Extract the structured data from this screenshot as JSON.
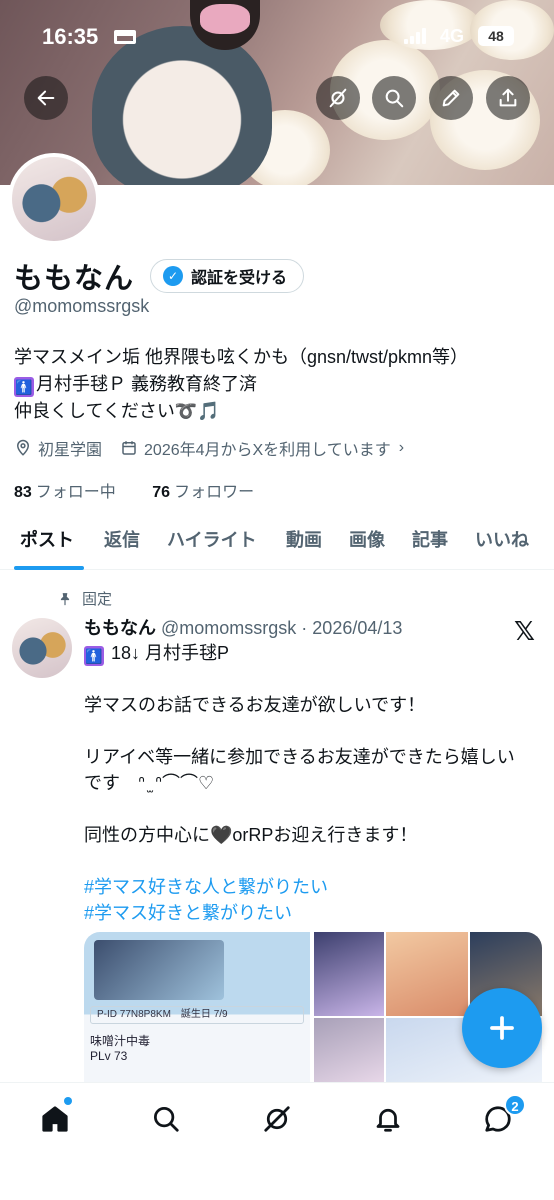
{
  "status_bar": {
    "time": "16:35",
    "network": "4G",
    "battery": "48"
  },
  "profile": {
    "name": "ももなん",
    "verify_label": "認証を受ける",
    "handle": "@momomssrgsk",
    "bio_line1": "学マスメイン垢 他界隈も呟くかも（gnsn/twst/pkmn等）",
    "bio_line2": "月村手毬Ｐ 義務教育終了済",
    "bio_line3": "仲良くしてください➰🎵",
    "location": "初星学園",
    "joined": "2026年4月からXを利用しています",
    "following_count": "83",
    "following_label": "フォロー中",
    "followers_count": "76",
    "followers_label": "フォロワー"
  },
  "tabs": [
    "ポスト",
    "返信",
    "ハイライト",
    "動画",
    "画像",
    "記事",
    "いいね"
  ],
  "post": {
    "pinned_label": "固定",
    "author": "ももなん",
    "meta": "@momomssrgsk · 2026/04/13",
    "line_intro": "18↓ 月村手毬P",
    "para1": "学マスのお話できるお友達が欲しいです！",
    "para2a": "リアイベ等一緒に参加できるお友達ができたら嬉しい",
    "para2b": "です　ᐢ ̫ ᐢ⌒⌒♡",
    "para3": "同性の方中心に🖤orRPお迎え行きます！",
    "hashtag1": "#学マス好きな人と繋がりたい",
    "hashtag2": "#学マス好きと繋がりたい",
    "media_id": "P-ID 77N8P8KM",
    "media_birthday": "誕生日 7/9",
    "media_name": "味噌汁中毒",
    "media_plv": "PLv 73"
  },
  "bottom_nav": {
    "messages_badge": "2"
  },
  "colors": {
    "accent": "#1d9bf0",
    "text": "#0f1419",
    "muted": "#536471"
  },
  "icons": [
    "back-arrow-icon",
    "grok-icon",
    "search-icon",
    "edit-icon",
    "share-icon",
    "location-icon",
    "calendar-icon",
    "pin-icon",
    "x-logo-icon",
    "plus-icon",
    "home-icon",
    "bell-icon",
    "messages-icon"
  ]
}
